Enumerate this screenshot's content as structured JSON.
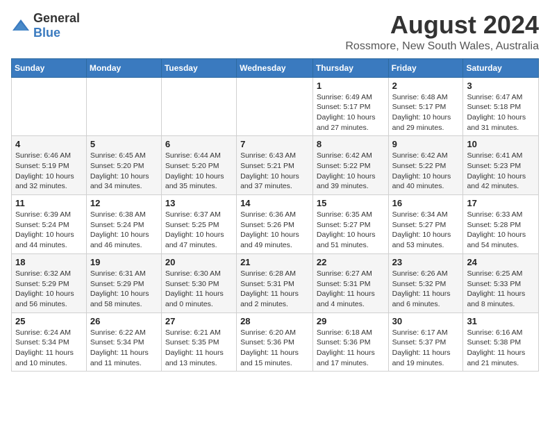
{
  "header": {
    "logo_general": "General",
    "logo_blue": "Blue",
    "main_title": "August 2024",
    "subtitle": "Rossmore, New South Wales, Australia"
  },
  "calendar": {
    "days_of_week": [
      "Sunday",
      "Monday",
      "Tuesday",
      "Wednesday",
      "Thursday",
      "Friday",
      "Saturday"
    ],
    "weeks": [
      [
        {
          "day": "",
          "detail": ""
        },
        {
          "day": "",
          "detail": ""
        },
        {
          "day": "",
          "detail": ""
        },
        {
          "day": "",
          "detail": ""
        },
        {
          "day": "1",
          "detail": "Sunrise: 6:49 AM\nSunset: 5:17 PM\nDaylight: 10 hours and 27 minutes."
        },
        {
          "day": "2",
          "detail": "Sunrise: 6:48 AM\nSunset: 5:17 PM\nDaylight: 10 hours and 29 minutes."
        },
        {
          "day": "3",
          "detail": "Sunrise: 6:47 AM\nSunset: 5:18 PM\nDaylight: 10 hours and 31 minutes."
        }
      ],
      [
        {
          "day": "4",
          "detail": "Sunrise: 6:46 AM\nSunset: 5:19 PM\nDaylight: 10 hours and 32 minutes."
        },
        {
          "day": "5",
          "detail": "Sunrise: 6:45 AM\nSunset: 5:20 PM\nDaylight: 10 hours and 34 minutes."
        },
        {
          "day": "6",
          "detail": "Sunrise: 6:44 AM\nSunset: 5:20 PM\nDaylight: 10 hours and 35 minutes."
        },
        {
          "day": "7",
          "detail": "Sunrise: 6:43 AM\nSunset: 5:21 PM\nDaylight: 10 hours and 37 minutes."
        },
        {
          "day": "8",
          "detail": "Sunrise: 6:42 AM\nSunset: 5:22 PM\nDaylight: 10 hours and 39 minutes."
        },
        {
          "day": "9",
          "detail": "Sunrise: 6:42 AM\nSunset: 5:22 PM\nDaylight: 10 hours and 40 minutes."
        },
        {
          "day": "10",
          "detail": "Sunrise: 6:41 AM\nSunset: 5:23 PM\nDaylight: 10 hours and 42 minutes."
        }
      ],
      [
        {
          "day": "11",
          "detail": "Sunrise: 6:39 AM\nSunset: 5:24 PM\nDaylight: 10 hours and 44 minutes."
        },
        {
          "day": "12",
          "detail": "Sunrise: 6:38 AM\nSunset: 5:24 PM\nDaylight: 10 hours and 46 minutes."
        },
        {
          "day": "13",
          "detail": "Sunrise: 6:37 AM\nSunset: 5:25 PM\nDaylight: 10 hours and 47 minutes."
        },
        {
          "day": "14",
          "detail": "Sunrise: 6:36 AM\nSunset: 5:26 PM\nDaylight: 10 hours and 49 minutes."
        },
        {
          "day": "15",
          "detail": "Sunrise: 6:35 AM\nSunset: 5:27 PM\nDaylight: 10 hours and 51 minutes."
        },
        {
          "day": "16",
          "detail": "Sunrise: 6:34 AM\nSunset: 5:27 PM\nDaylight: 10 hours and 53 minutes."
        },
        {
          "day": "17",
          "detail": "Sunrise: 6:33 AM\nSunset: 5:28 PM\nDaylight: 10 hours and 54 minutes."
        }
      ],
      [
        {
          "day": "18",
          "detail": "Sunrise: 6:32 AM\nSunset: 5:29 PM\nDaylight: 10 hours and 56 minutes."
        },
        {
          "day": "19",
          "detail": "Sunrise: 6:31 AM\nSunset: 5:29 PM\nDaylight: 10 hours and 58 minutes."
        },
        {
          "day": "20",
          "detail": "Sunrise: 6:30 AM\nSunset: 5:30 PM\nDaylight: 11 hours and 0 minutes."
        },
        {
          "day": "21",
          "detail": "Sunrise: 6:28 AM\nSunset: 5:31 PM\nDaylight: 11 hours and 2 minutes."
        },
        {
          "day": "22",
          "detail": "Sunrise: 6:27 AM\nSunset: 5:31 PM\nDaylight: 11 hours and 4 minutes."
        },
        {
          "day": "23",
          "detail": "Sunrise: 6:26 AM\nSunset: 5:32 PM\nDaylight: 11 hours and 6 minutes."
        },
        {
          "day": "24",
          "detail": "Sunrise: 6:25 AM\nSunset: 5:33 PM\nDaylight: 11 hours and 8 minutes."
        }
      ],
      [
        {
          "day": "25",
          "detail": "Sunrise: 6:24 AM\nSunset: 5:34 PM\nDaylight: 11 hours and 10 minutes."
        },
        {
          "day": "26",
          "detail": "Sunrise: 6:22 AM\nSunset: 5:34 PM\nDaylight: 11 hours and 11 minutes."
        },
        {
          "day": "27",
          "detail": "Sunrise: 6:21 AM\nSunset: 5:35 PM\nDaylight: 11 hours and 13 minutes."
        },
        {
          "day": "28",
          "detail": "Sunrise: 6:20 AM\nSunset: 5:36 PM\nDaylight: 11 hours and 15 minutes."
        },
        {
          "day": "29",
          "detail": "Sunrise: 6:18 AM\nSunset: 5:36 PM\nDaylight: 11 hours and 17 minutes."
        },
        {
          "day": "30",
          "detail": "Sunrise: 6:17 AM\nSunset: 5:37 PM\nDaylight: 11 hours and 19 minutes."
        },
        {
          "day": "31",
          "detail": "Sunrise: 6:16 AM\nSunset: 5:38 PM\nDaylight: 11 hours and 21 minutes."
        }
      ]
    ]
  }
}
